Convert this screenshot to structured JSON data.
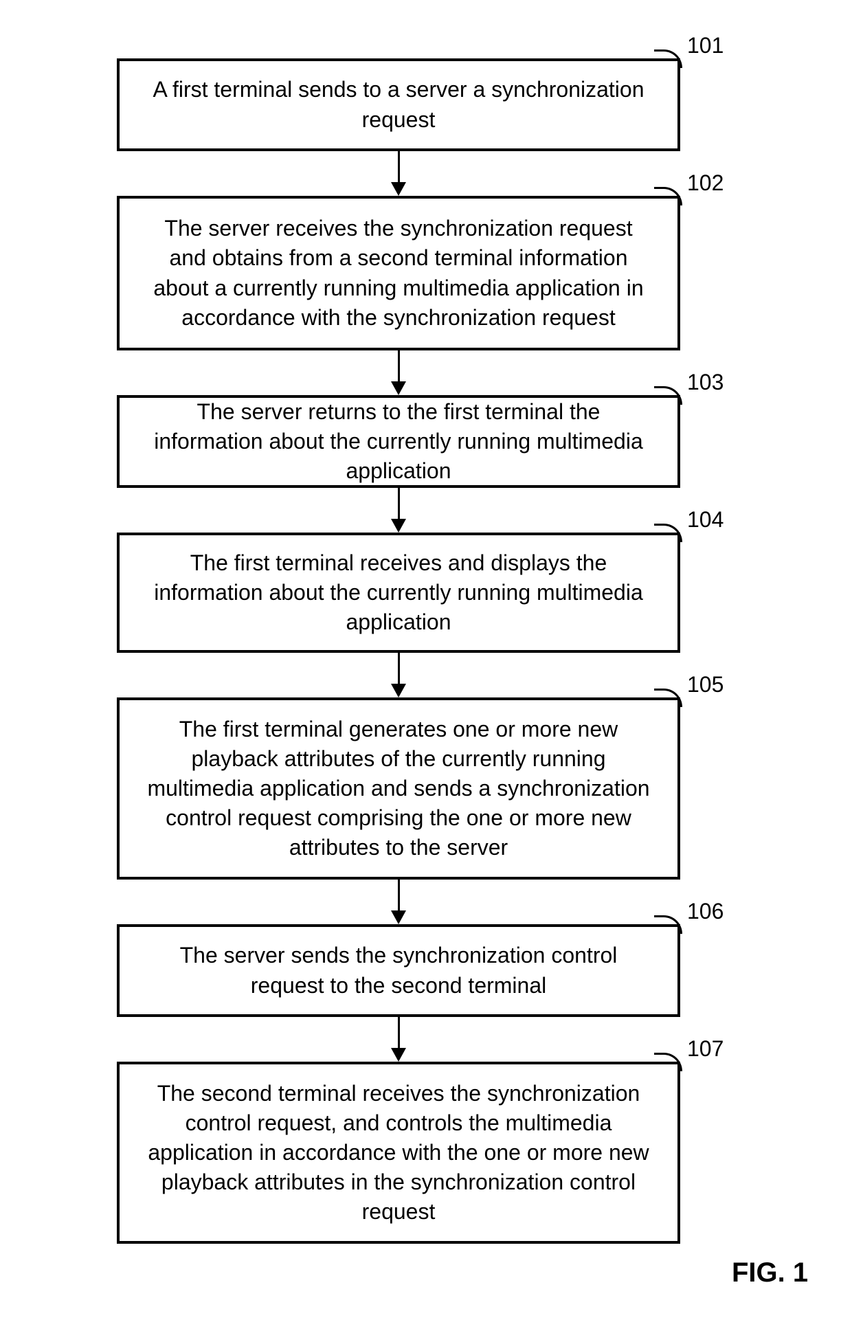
{
  "figure_label": "FIG. 1",
  "steps": [
    {
      "num": "101",
      "text": "A first terminal sends to a server a synchronization request"
    },
    {
      "num": "102",
      "text": "The server receives the synchronization request and obtains from a second terminal information about a currently running multimedia application in accordance with the synchronization request"
    },
    {
      "num": "103",
      "text": "The server returns to the first terminal the information about the currently running multimedia application"
    },
    {
      "num": "104",
      "text": "The first terminal receives and displays the information about the currently running multimedia application"
    },
    {
      "num": "105",
      "text": "The first terminal generates one or more new playback attributes of the currently running multimedia application and sends a synchronization control request comprising the one or more new attributes to the server"
    },
    {
      "num": "106",
      "text": "The server sends the synchronization control request to the second terminal"
    },
    {
      "num": "107",
      "text": "The second terminal receives the synchronization control request, and controls the multimedia application in accordance with the one or more new playback attributes in the synchronization control request"
    }
  ]
}
